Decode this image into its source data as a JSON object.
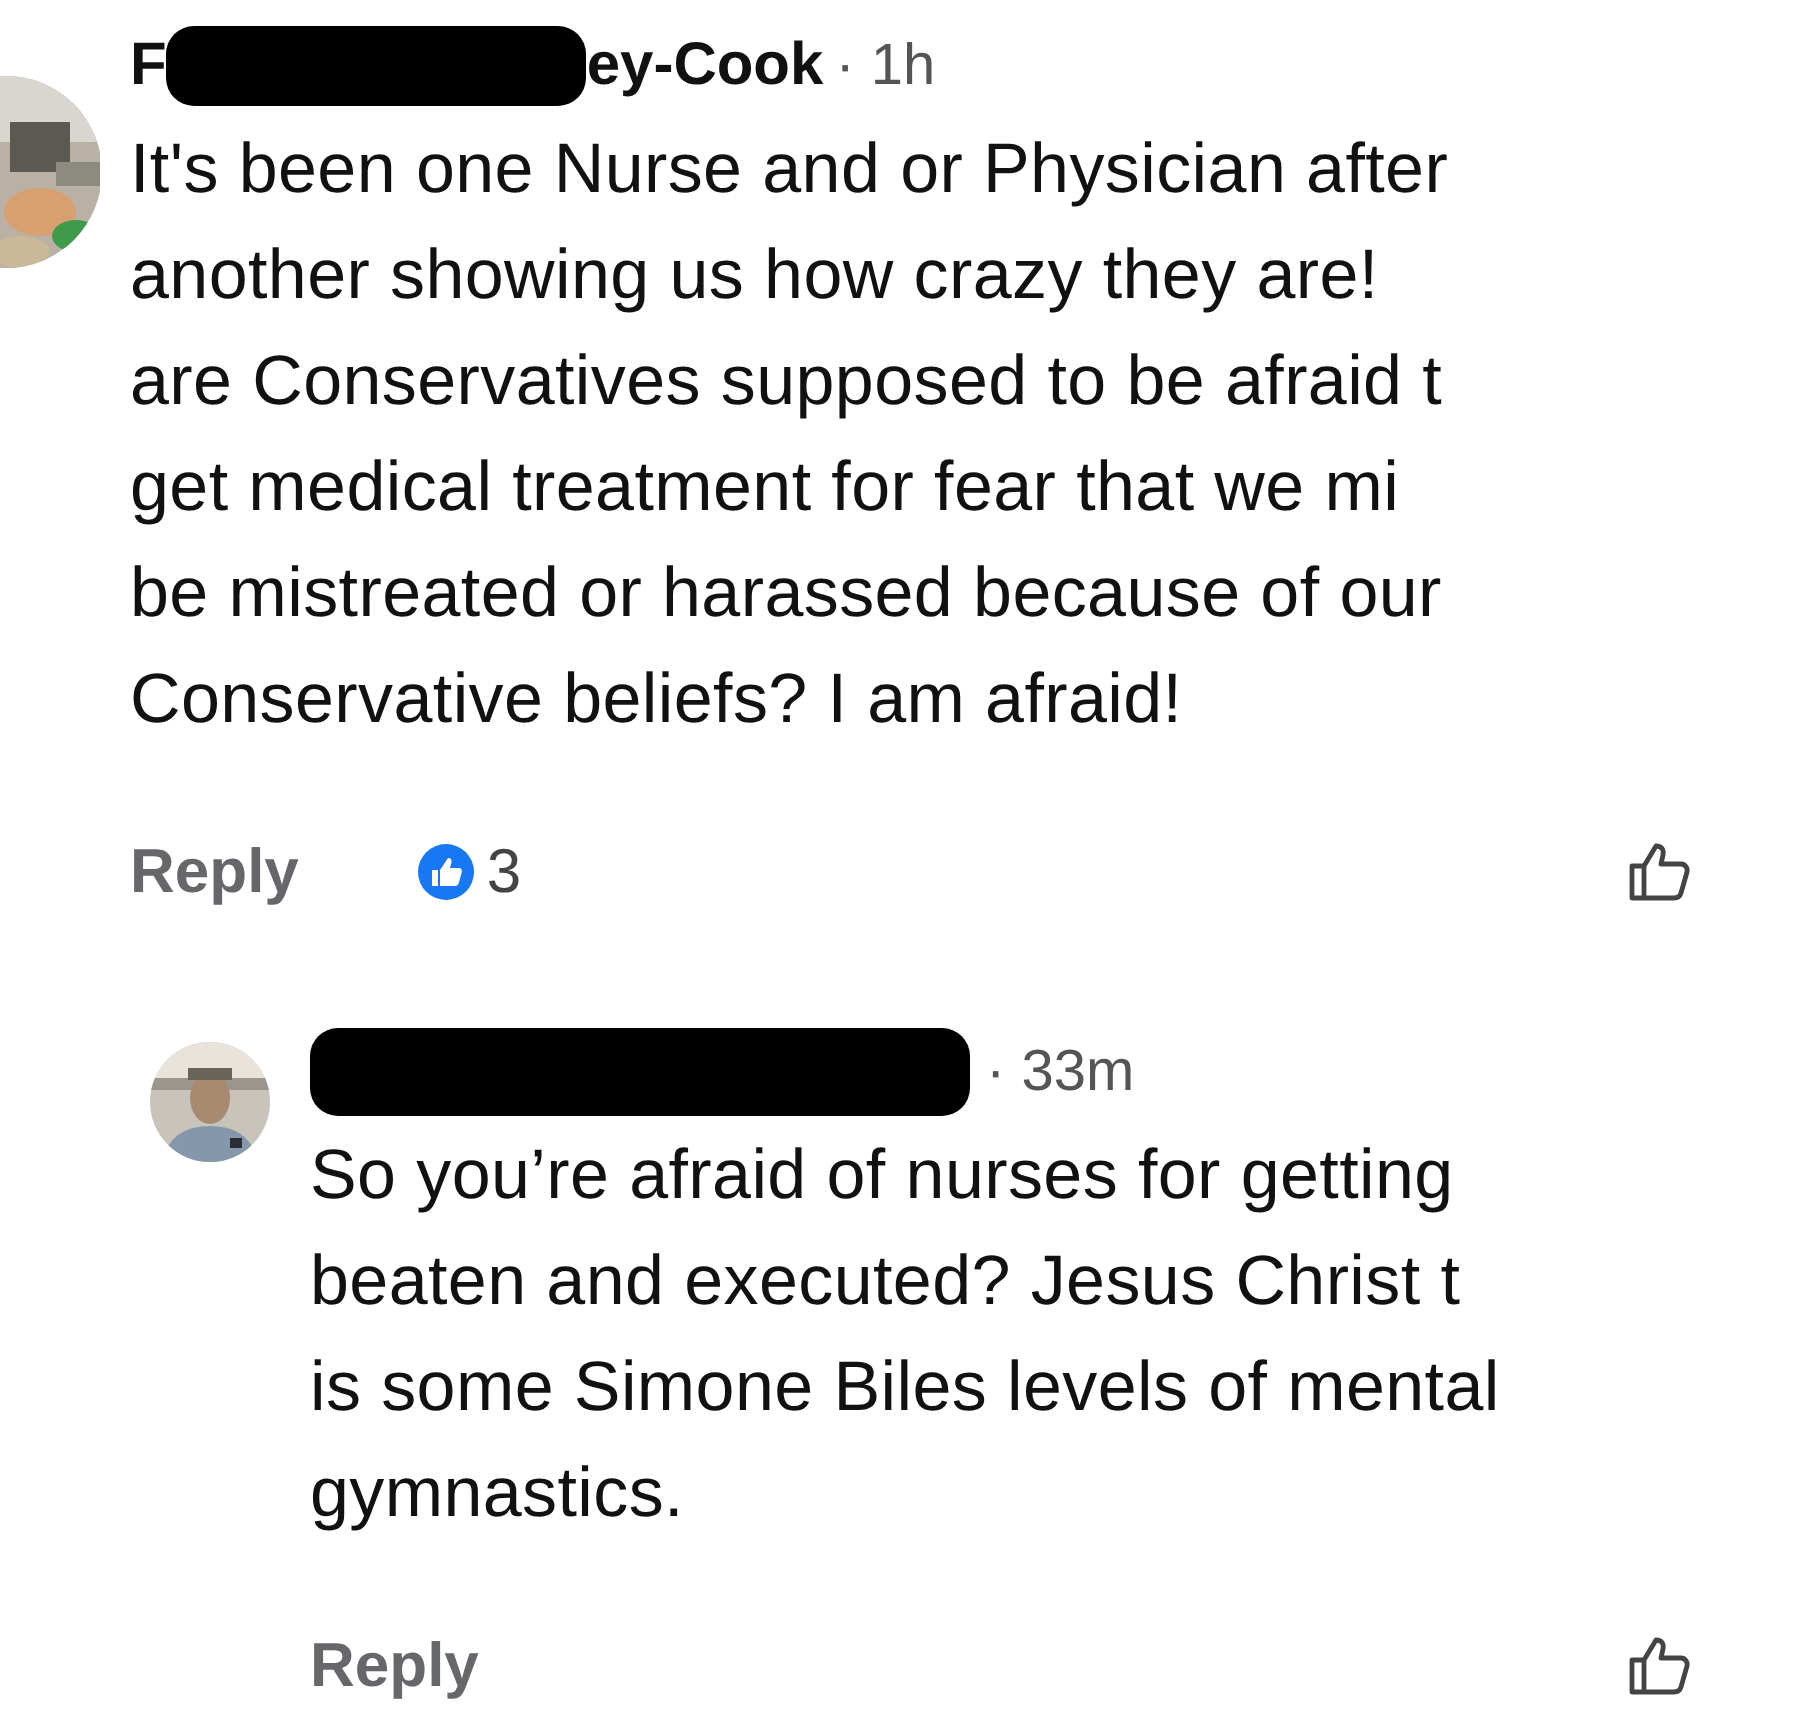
{
  "comments": [
    {
      "author_visible": [
        "F",
        "ey-Cook"
      ],
      "time": "· 1h",
      "reply_level": false,
      "lines": [
        "It's been one Nurse and or Physician after",
        "another showing us how crazy they are!",
        "are Conservatives supposed to be afraid t",
        "get medical treatment for fear that we mi",
        "be mistreated or harassed because of our",
        "Conservative beliefs?   I am afraid!"
      ],
      "reply": "Reply",
      "likes": "3"
    },
    {
      "time": "· 33m",
      "reply_level": true,
      "lines": [
        "So you’re afraid of nurses for getting",
        "beaten and executed? Jesus Christ t",
        "is some Simone Biles levels of mental",
        "gymnastics."
      ],
      "reply": "Reply"
    }
  ]
}
